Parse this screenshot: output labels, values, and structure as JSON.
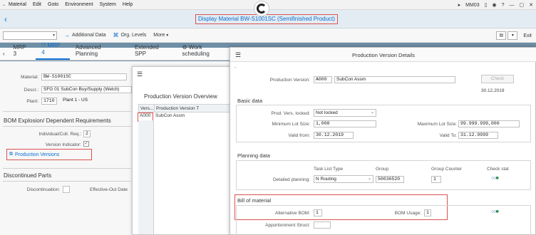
{
  "menubar": {
    "items": [
      "Material",
      "Edit",
      "Goto",
      "Environment",
      "System",
      "Help"
    ],
    "tcode": "MM03",
    "chevron": "⌄"
  },
  "titlebar": {
    "back_icon": "‹",
    "title": "Display Material BW-S1001SC (Semifinished Product)"
  },
  "toolbar": {
    "additional_data": "Additional Data",
    "org_levels": "Org. Levels",
    "more": "More",
    "exit": "Exit"
  },
  "tabs": {
    "mrp3": "MRP 3",
    "mrp4": "MRP 4",
    "advanced_planning": "Advanced Planning",
    "extended_spp": "Extended SPP",
    "work_scheduling": "Work scheduling"
  },
  "base": {
    "material_label": "Material:",
    "material_value": "BW-S1001SC",
    "descr_label": "Descr.:",
    "descr_value": "SFG 01 SubCon Buy/Supply (Welch)",
    "plant_label": "Plant:",
    "plant_value": "1710",
    "plant_name": "Plant 1 - US",
    "bom_section": "BOM Explosion/ Dependent Requirements",
    "indiv_label": "Individual/Coll. Req.:",
    "indiv_value": "2",
    "version_label": "Version Indicator:",
    "version_checked": "✓",
    "prod_versions_button": "Production Versions",
    "discontinued_section": "Discontinued Parts",
    "discontinuation_label": "Discontinuation:",
    "effective_out_label": "Effective-Out Date"
  },
  "overview": {
    "title": "Production Version Overview",
    "columns": [
      "Vers...",
      "Production Version T"
    ],
    "rows": [
      {
        "version": "A000",
        "text": "SubCon Assm"
      }
    ]
  },
  "details": {
    "title": "Production Version Details",
    "prod_version_label": "Production Version:",
    "prod_version_value": "A000",
    "prod_version_text": "SubCon Assm",
    "check_button": "Check",
    "date_stamp": "30.12.2019",
    "basic_data": {
      "title": "Basic data",
      "locked_label": "Prod. Vers. locked:",
      "locked_value": "Not locked",
      "min_lot_label": "Minimum Lot Size:",
      "min_lot_value": "1,000",
      "max_lot_label": "Maximum Lot Size:",
      "max_lot_value": "99.999.999,000",
      "valid_from_label": "Valid from:",
      "valid_from_value": "30.12.2019",
      "valid_to_label": "Valid To:",
      "valid_to_value": "31.12.9999"
    },
    "planning_data": {
      "title": "Planning data",
      "col_task_list_type": "Task List Type",
      "col_group": "Group",
      "col_group_counter": "Group Counter",
      "col_check_stat": "Check stat",
      "detailed_planning_label": "Detailed planning:",
      "task_list_type_value": "N Routing",
      "group_value": "50036520",
      "group_counter_value": "1"
    },
    "bill_of_material": {
      "title": "Bill of material",
      "alt_bom_label": "Alternative BOM:",
      "alt_bom_value": "1",
      "bom_usage_label": "BOM Usage:",
      "bom_usage_value": "1",
      "apportionment_label": "Apportionment Struct:"
    }
  },
  "colors": {
    "accent": "#0a6ed1",
    "highlight_red": "#d9534f",
    "status_green": "#2e8b57"
  }
}
